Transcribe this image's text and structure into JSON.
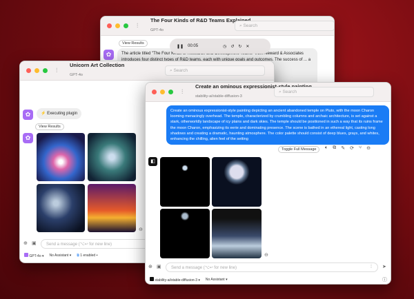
{
  "back_window": {
    "title": "The Four Kinds of R&D Teams Explained",
    "model": "GPT-4o",
    "search_placeholder": "Search",
    "view_results": "View Results",
    "message": "The article titled \"The Four Kinds of Research-and-Development Teams\" from Neward & Associates introduces four distinct types of R&D teams, each with unique goals and outcomes. The success of ... a brief overview of",
    "player": {
      "time": "00:05"
    }
  },
  "left_window": {
    "title": "Unicorn Art Collection",
    "model": "GPT-4o",
    "search_placeholder": "Search",
    "status": "Executing plugin",
    "view_results": "View Results",
    "input_placeholder": "Send a message (⌥↩ for new line)",
    "model_select": "GPT-4o",
    "assistant_select": "No Assistant",
    "plugins": "1 enabled"
  },
  "front_window": {
    "title": "Create an ominous expressionist-style painting...",
    "model": "stability-ai/stable-diffusion-3",
    "search_placeholder": "Search",
    "prompt": "Create an ominous expressionist-style painting depicting an ancient abandoned temple on Pluto, with the moon Charon looming menacingly overhead. The temple, characterized by crumbling columns and archaic architecture, is set against a stark, otherworldly landscape of icy plains and dark skies. The temple should be positioned in such a way that its ruins frame the moon Charon, emphasizing its eerie and dominating presence. The scene is bathed in an ethereal light, casting long shadows and creating a dramatic, haunting atmosphere. The color palette should consist of deep blues, grays, and whites, enhancing the chilling, alien feel of the setting",
    "toggle": "Toggle Full Message",
    "input_placeholder": "Send a message (⌥↩ for new line)",
    "model_select": "stability-ai/stable-diffusion-3",
    "assistant_select": "No Assistant"
  },
  "colors": {
    "accent": "#1a7cf5",
    "bot": "#a86cf5"
  }
}
